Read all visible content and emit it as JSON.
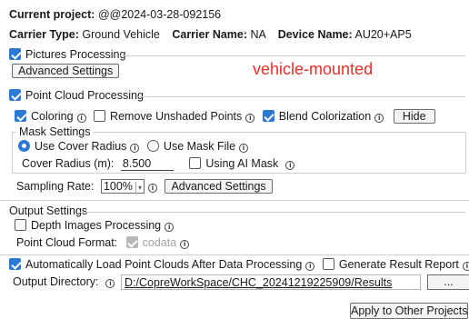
{
  "header": {
    "current_project_label": "Current project:",
    "current_project_value": "@@2024-03-28-092156",
    "carrier_type_label": "Carrier Type:",
    "carrier_type_value": "Ground Vehicle",
    "carrier_name_label": "Carrier Name:",
    "carrier_name_value": "NA",
    "device_name_label": "Device Name:",
    "device_name_value": "AU20+AP5"
  },
  "pictures": {
    "label": "Pictures Processing",
    "checked": true,
    "advanced_button": "Advanced Settings",
    "annotation": "vehicle-mounted",
    "annotation_color": "#e8302a"
  },
  "point_cloud": {
    "label": "Point Cloud Processing",
    "checked": true,
    "coloring_label": "Coloring",
    "coloring_checked": true,
    "remove_unshaded_label": "Remove Unshaded Points",
    "remove_unshaded_checked": false,
    "blend_label": "Blend Colorization",
    "blend_checked": true,
    "hide_button": "Hide",
    "mask_settings_title": "Mask Settings",
    "use_cover_radius_label": "Use Cover Radius",
    "use_mask_file_label": "Use Mask File",
    "selected_mask_option": "Use Cover Radius",
    "cover_radius_label": "Cover Radius (m):",
    "cover_radius_value": "8.500",
    "ai_mask_label": "Using AI Mask",
    "ai_mask_checked": false,
    "sampling_rate_label": "Sampling Rate:",
    "sampling_rate_value": "100%",
    "sampling_advanced_button": "Advanced Settings"
  },
  "output": {
    "title": "Output Settings",
    "depth_images_label": "Depth Images Processing",
    "depth_images_checked": false,
    "point_cloud_format_label": "Point Cloud Format:",
    "point_cloud_format_value": "codata",
    "auto_load_label": "Automatically Load Point Clouds After Data Processing",
    "auto_load_checked": true,
    "generate_report_label": "Generate Result Report",
    "generate_report_checked": false,
    "output_dir_label": "Output Directory:",
    "output_dir_value": "D:/CopreWorkSpace/CHC_20241219225909/Results",
    "browse_button": "..."
  },
  "footer": {
    "apply_button": "Apply to Other Projects"
  },
  "colors": {
    "accent": "#2b7bd6",
    "annotation": "#e8302a"
  },
  "icons": [
    "info-icon",
    "checkbox-icon",
    "radio-icon",
    "dropdown-arrow-icon"
  ]
}
